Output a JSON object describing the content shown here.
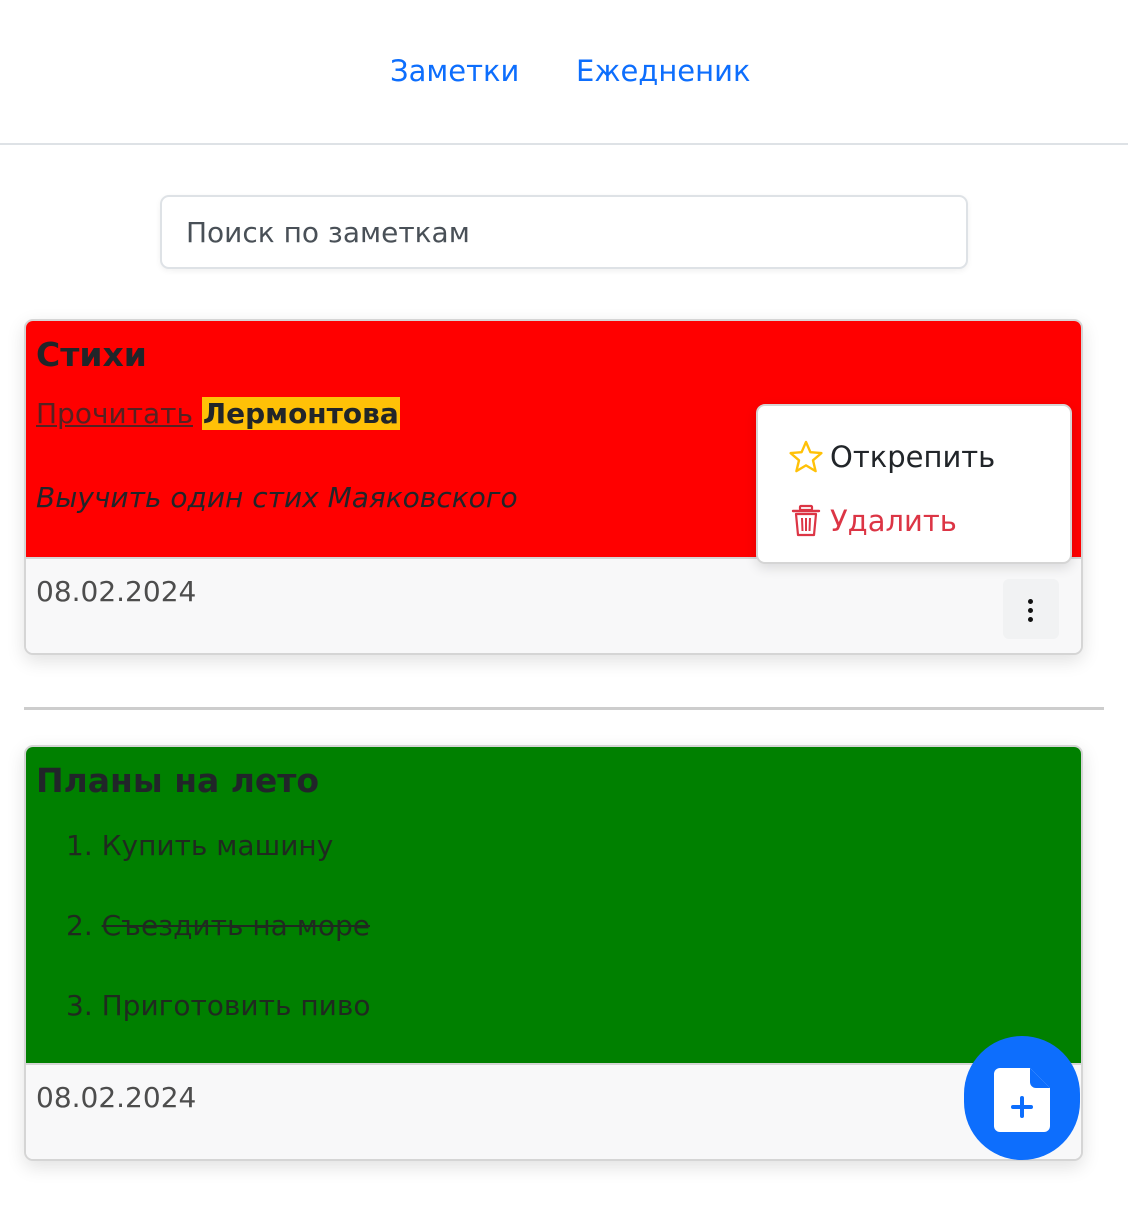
{
  "nav": {
    "notes_label": "Заметки",
    "diary_label": "Ежедненик",
    "link_color": "#0d6efd"
  },
  "search": {
    "placeholder": "Поиск по заметкам",
    "value": ""
  },
  "notes": [
    {
      "title": "Стихи",
      "color": "#ff0000",
      "line1_underlined": "Прочитать",
      "line1_highlight": "Лермонтова",
      "line2_italic": "Выучить один стих Маяковского",
      "date": "08.02.2024"
    },
    {
      "title": "Планы на лето",
      "color": "#008000",
      "items": [
        {
          "number": "1.",
          "text": "Купить машину",
          "struck": false
        },
        {
          "number": "2.",
          "text": "Съездить на море",
          "struck": true
        },
        {
          "number": "3.",
          "text": "Приготовить пиво",
          "struck": false
        }
      ],
      "date": "08.02.2024"
    }
  ],
  "context_menu": {
    "unpin_label": "Открепить",
    "unpin_icon": "star-outline-icon",
    "delete_label": "Удалить",
    "delete_icon": "trash-icon",
    "delete_color": "#dc3545",
    "star_color": "#ffc107"
  },
  "kebab_icon": "three-dots-vertical-icon",
  "fab": {
    "icon": "file-plus-icon",
    "color": "#0d6efd"
  }
}
